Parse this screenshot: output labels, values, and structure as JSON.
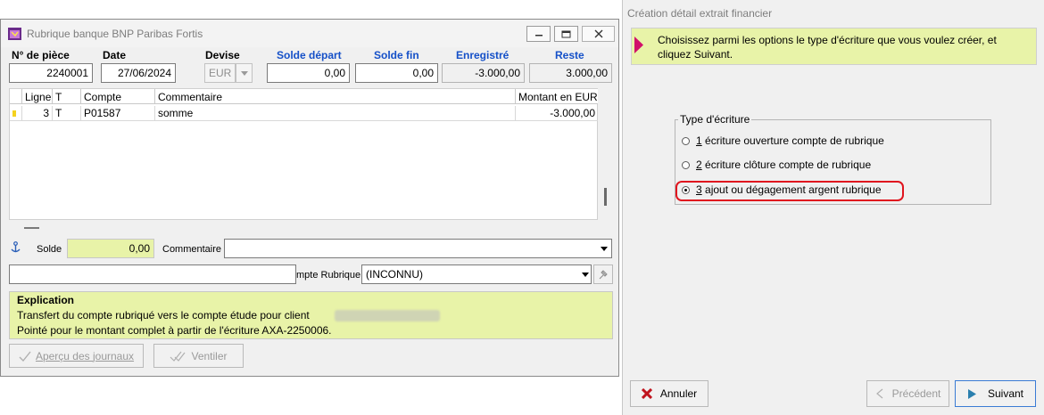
{
  "left_window": {
    "title": "Rubrique banque BNP Paribas Fortis",
    "buttons": {
      "minimize": "minimize",
      "maximize": "maximize",
      "close": "close"
    },
    "headers": {
      "piece": "N° de pièce",
      "date": "Date",
      "devise": "Devise",
      "solde_depart": "Solde départ",
      "solde_fin": "Solde fin",
      "enregistre": "Enregistré",
      "reste": "Reste"
    },
    "values": {
      "piece": "2240001",
      "date": "27/06/2024",
      "devise": "EUR",
      "solde_depart": "0,00",
      "solde_fin": "0,00",
      "enregistre": "-3.000,00",
      "reste": "3.000,00"
    },
    "table": {
      "columns": [
        "Ligne",
        "T",
        "Compte",
        "Commentaire",
        "Montant en EUR"
      ],
      "rows": [
        {
          "ligne": "3",
          "t": "T",
          "compte": "P01587",
          "commentaire": "somme",
          "montant": "-3.000,00"
        }
      ]
    },
    "solde_label": "Solde",
    "solde_value": "0,00",
    "commentaire_label": "Commentaire",
    "commentaire_value": "",
    "compte_left_value": "",
    "compte_rubrique_label": "mpte Rubrique",
    "compte_rubrique_value": "(INCONNU)",
    "explication": {
      "title": "Explication",
      "line1": "Transfert du compte rubriqué vers le compte étude pour client",
      "line2": "Pointé pour le montant complet à partir de l'écriture AXA-2250006."
    },
    "btn_apercu": "Aperçu des journaux",
    "btn_ventiler": "Ventiler"
  },
  "right_window": {
    "title": "Création détail extrait financier",
    "instruction_line1": "Choisissez parmi les options le type d'écriture que vous voulez créer, et",
    "instruction_line2": "cliquez Suivant.",
    "group_label": "Type d'écriture",
    "options": [
      {
        "num": "1",
        "label": " écriture ouverture compte de rubrique",
        "selected": false
      },
      {
        "num": "2",
        "label": " écriture clôture compte de rubrique",
        "selected": false
      },
      {
        "num": "3",
        "label": " ajout ou dégagement argent rubrique",
        "selected": true
      }
    ],
    "btn_annuler": "Annuler",
    "btn_precedent": "Précédent",
    "btn_suivant": "Suivant"
  },
  "colors": {
    "highlight_yellow": "#e8f3a8",
    "header_blue": "#1550c8",
    "annotation_red": "#e0141e",
    "arrow_magenta": "#d0106a"
  }
}
